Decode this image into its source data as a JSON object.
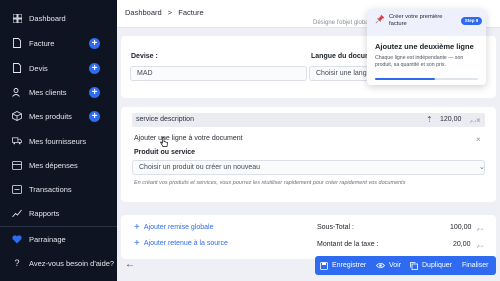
{
  "sidebar": {
    "items": [
      {
        "label": "Dashboard",
        "icon": "grid-icon",
        "has_add": false
      },
      {
        "label": "Facture",
        "icon": "document-icon",
        "has_add": true
      },
      {
        "label": "Devis",
        "icon": "document-icon",
        "has_add": true
      },
      {
        "label": "Mes clients",
        "icon": "users-icon",
        "has_add": true
      },
      {
        "label": "Mes produits",
        "icon": "box-icon",
        "has_add": true
      },
      {
        "label": "Mes fournisseurs",
        "icon": "truck-icon",
        "has_add": false
      },
      {
        "label": "Mes dépenses",
        "icon": "receipt-icon",
        "has_add": false
      },
      {
        "label": "Transactions",
        "icon": "transactions-icon",
        "has_add": false
      },
      {
        "label": "Rapports",
        "icon": "chart-icon",
        "has_add": false
      }
    ],
    "parrainage": "Parrainage",
    "help": "Avez-vous besoin d'aide?"
  },
  "header": {
    "breadcrumb": [
      "Dashboard",
      ">",
      "Facture"
    ],
    "subtext": "Désigne l'objet global"
  },
  "settings": {
    "devise_label": "Devise :",
    "devise_value": "MAD",
    "langue_label": "Langue du document",
    "langue_placeholder": "Choisir une langue"
  },
  "line": {
    "description": "service description",
    "amount": "120,00",
    "unit": "د.م",
    "add_line_text": "Ajouter une ligne à votre document",
    "product_label": "Produit ou service",
    "product_placeholder": "Choisir un produit ou créer un nouveau",
    "hint": "En créant vos produits et services, vous pourrez les réutiliser rapidement pour créer rapidement vos documents"
  },
  "totals": {
    "remise_link": "Ajouter remise globale",
    "retenue_link": "Ajouter retenue à la source",
    "sous_total_label": "Sous-Total :",
    "sous_total_value": "100,00",
    "taxe_label": "Montant de la taxe :",
    "taxe_value": "20,00",
    "unit": "د.م"
  },
  "actions": {
    "save": "Enregistrer",
    "view": "Voir",
    "duplicate": "Dupliquer",
    "finalize": "Finaliser"
  },
  "tour": {
    "title": "Créer votre première facture",
    "step": "Step 9",
    "heading": "Ajoutez une deuxième ligne",
    "body": "Chaque ligne est indépendante — son produit, sa quantité et son prix.",
    "progress": 0.58
  },
  "colors": {
    "accent": "#2f6bf0",
    "sidebar_bg": "#0f1422",
    "heart": "#2f6bf0"
  }
}
